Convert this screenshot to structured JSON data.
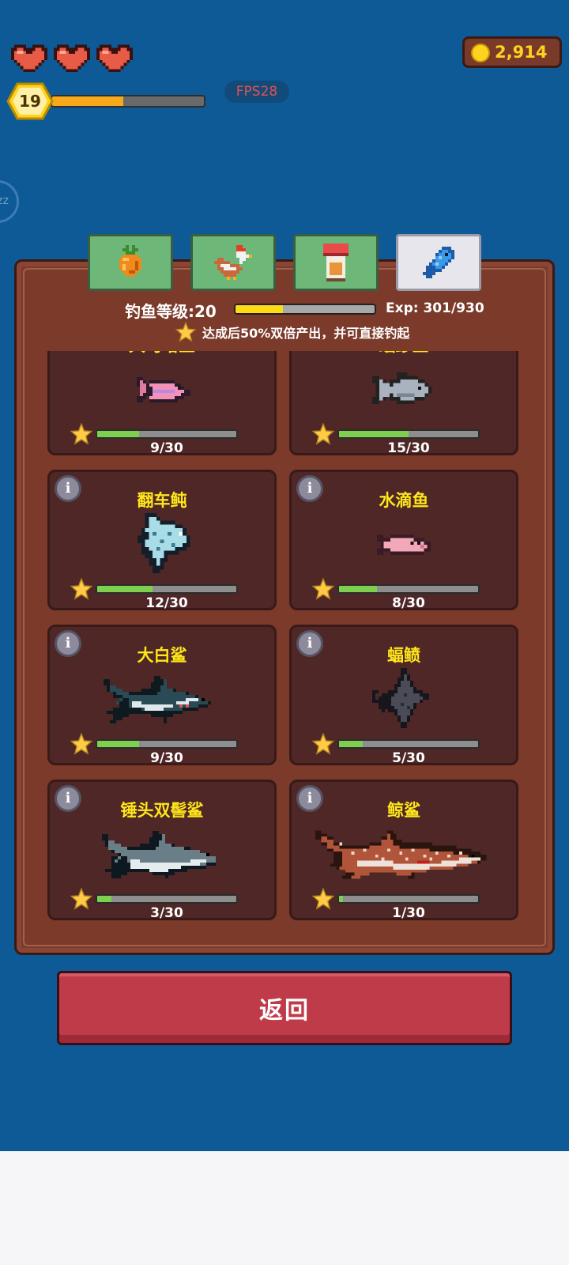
{
  "hud": {
    "hearts": [
      {
        "icon": "heart-icon"
      },
      {
        "icon": "heart-icon"
      },
      {
        "icon": "heart-icon"
      }
    ],
    "level": "19",
    "xp_progress": 0.47,
    "fps": "FPS28",
    "coins": "2,914"
  },
  "tabs": [
    {
      "name": "carrot-tab",
      "icon": "carrot-icon",
      "active": false
    },
    {
      "name": "chicken-tab",
      "icon": "chicken-icon",
      "active": false
    },
    {
      "name": "jar-tab",
      "icon": "jar-icon",
      "active": false
    },
    {
      "name": "fish-tab",
      "icon": "fish-icon",
      "active": true
    }
  ],
  "fishing": {
    "level_label": "钓鱼等级:20",
    "level_progress": 0.34,
    "exp_label": "Exp: 301/930",
    "bonus_text": "达成后50%双倍产出，并可直接钓起"
  },
  "fish_cards": [
    {
      "name": "大马哈鱼",
      "progress_text": "9/30",
      "progress": 0.3,
      "icon": "salmon-icon"
    },
    {
      "name": "蝠鲹鱼",
      "progress_text": "15/30",
      "progress": 0.5,
      "icon": "grey-fish-icon"
    },
    {
      "name": "翻车鲀",
      "progress_text": "12/30",
      "progress": 0.4,
      "icon": "sunfish-icon"
    },
    {
      "name": "水滴鱼",
      "progress_text": "8/30",
      "progress": 0.27,
      "icon": "blobfish-icon"
    },
    {
      "name": "大白鲨",
      "progress_text": "9/30",
      "progress": 0.3,
      "icon": "great-white-shark-icon"
    },
    {
      "name": "蝠鲼",
      "progress_text": "5/30",
      "progress": 0.17,
      "icon": "manta-ray-icon"
    },
    {
      "name": "锤头双髻鲨",
      "progress_text": "3/30",
      "progress": 0.1,
      "icon": "hammerhead-shark-icon"
    },
    {
      "name": "鲸鲨",
      "progress_text": "1/30",
      "progress": 0.03,
      "icon": "whale-shark-icon"
    }
  ],
  "back_button": "返回",
  "colors": {
    "background": "#0d5a96",
    "panel": "#7b3a2a",
    "card": "#4e2726",
    "fish_name": "#ffe71a",
    "progress_fill": "#7fcf4f",
    "back_button": "#bf3b49"
  }
}
